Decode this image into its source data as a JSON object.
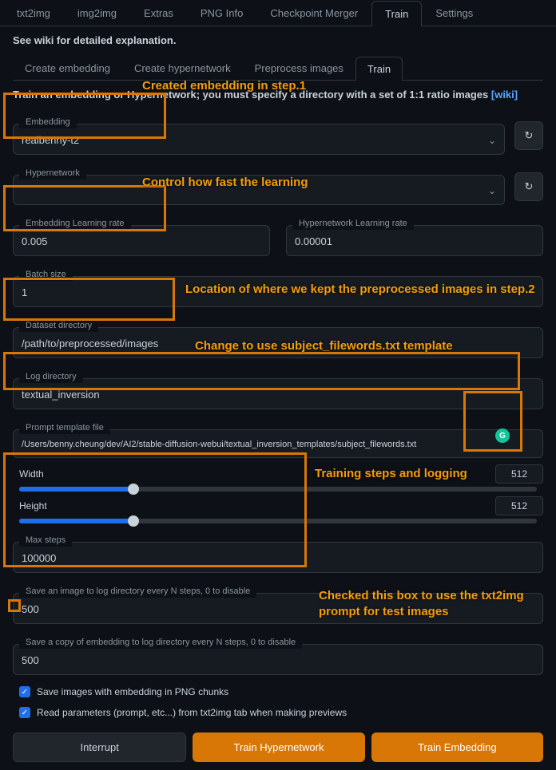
{
  "tabs": {
    "txt2img": "txt2img",
    "img2img": "img2img",
    "extras": "Extras",
    "pnginfo": "PNG Info",
    "checkpoint": "Checkpoint Merger",
    "train": "Train",
    "settings": "Settings"
  },
  "wiki_note": "See wiki for detailed explanation.",
  "subtabs": {
    "create_embedding": "Create embedding",
    "create_hypernetwork": "Create hypernetwork",
    "preprocess": "Preprocess images",
    "train": "Train"
  },
  "description_prefix": "Train an embedding or Hypernetwork; you must specify a directory with a set of 1:1 ratio images ",
  "description_link": "[wiki]",
  "fields": {
    "embedding_label": "Embedding",
    "embedding_value": "realbenny-t2",
    "hypernetwork_label": "Hypernetwork",
    "hypernetwork_value": "",
    "emb_lr_label": "Embedding Learning rate",
    "emb_lr_value": "0.005",
    "hyp_lr_label": "Hypernetwork Learning rate",
    "hyp_lr_value": "0.00001",
    "batch_label": "Batch size",
    "batch_value": "1",
    "dataset_label": "Dataset directory",
    "dataset_value": "/path/to/preprocessed/images",
    "log_label": "Log directory",
    "log_value": "textual_inversion",
    "prompt_label": "Prompt template file",
    "prompt_value": "/Users/benny.cheung/dev/AI2/stable-diffusion-webui/textual_inversion_templates/subject_filewords.txt",
    "width_label": "Width",
    "width_value": "512",
    "height_label": "Height",
    "height_value": "512",
    "maxsteps_label": "Max steps",
    "maxsteps_value": "100000",
    "saveimg_label": "Save an image to log directory every N steps, 0 to disable",
    "saveimg_value": "500",
    "savecopy_label": "Save a copy of embedding to log directory every N steps, 0 to disable",
    "savecopy_value": "500"
  },
  "checkboxes": {
    "png_chunks": "Save images with embedding in PNG chunks",
    "read_params": "Read parameters (prompt, etc...) from txt2img tab when making previews"
  },
  "buttons": {
    "interrupt": "Interrupt",
    "train_hyper": "Train Hypernetwork",
    "train_embed": "Train Embedding"
  },
  "annotations": {
    "step1": "Created embedding in step.1",
    "learning": "Control how fast the learning",
    "location": "Location of where we kept the preprocessed images in step.2",
    "template": "Change to use subject_filewords.txt template",
    "training": "Training steps and logging",
    "checked": "Checked this box to use the txt2img prompt for test images"
  }
}
